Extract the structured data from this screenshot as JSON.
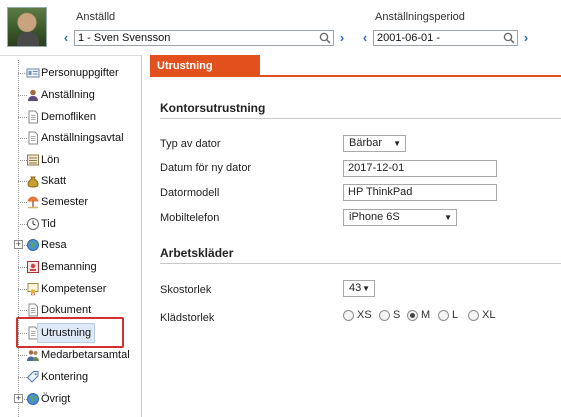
{
  "header": {
    "employee_label": "Anställd",
    "employee_value": "1 - Sven Svensson",
    "period_label": "Anställningsperiod",
    "period_value": "2001-06-01 -"
  },
  "sidebar": {
    "items": [
      {
        "label": "Personuppgifter",
        "icon": "id-card-icon"
      },
      {
        "label": "Anställning",
        "icon": "person-icon"
      },
      {
        "label": "Demofliken",
        "icon": "document-icon"
      },
      {
        "label": "Anställningsavtal",
        "icon": "document-icon"
      },
      {
        "label": "Lön",
        "icon": "ledger-icon"
      },
      {
        "label": "Skatt",
        "icon": "money-bag-icon"
      },
      {
        "label": "Semester",
        "icon": "beach-umbrella-icon"
      },
      {
        "label": "Tid",
        "icon": "clock-icon"
      },
      {
        "label": "Resa",
        "icon": "globe-icon",
        "expandable": true
      },
      {
        "label": "Bemanning",
        "icon": "staffing-icon"
      },
      {
        "label": "Kompetenser",
        "icon": "certificate-icon"
      },
      {
        "label": "Dokument",
        "icon": "document-icon"
      },
      {
        "label": "Utrustning",
        "icon": "document-icon",
        "selected": true
      },
      {
        "label": "Medarbetarsamtal",
        "icon": "people-icon"
      },
      {
        "label": "Kontering",
        "icon": "tag-icon"
      },
      {
        "label": "Övrigt",
        "icon": "globe-icon",
        "expandable": true
      }
    ],
    "highlight_color": "#d3302f"
  },
  "tab": {
    "label": "Utrustning",
    "color": "#e2511d"
  },
  "office_equipment": {
    "title": "Kontorsutrustning",
    "computer_type_label": "Typ av dator",
    "computer_type_value": "Bärbar",
    "new_computer_date_label": "Datum för ny dator",
    "new_computer_date_value": "2017-12-01",
    "computer_model_label": "Datormodell",
    "computer_model_value": "HP ThinkPad",
    "mobile_phone_label": "Mobiltelefon",
    "mobile_phone_value": "iPhone 6S"
  },
  "work_clothes": {
    "title": "Arbetskläder",
    "shoe_size_label": "Skostorlek",
    "shoe_size_value": "43",
    "clothing_size_label": "Klädstorlek",
    "clothing_sizes": [
      "XS",
      "S",
      "M",
      "L",
      "XL"
    ],
    "clothing_size_selected": "M"
  }
}
